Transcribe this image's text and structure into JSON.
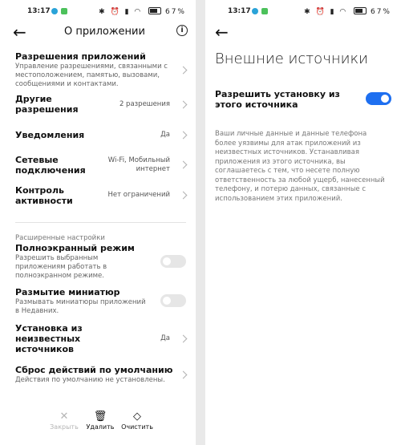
{
  "status_bar": {
    "time": "13:17",
    "battery": "67"
  },
  "left": {
    "title": "О приложении",
    "rows": [
      {
        "label": "Разрешения приложений",
        "desc": "Управление разрешениями, связанными с местоположением, памятью, вызовами, сообщениями и контактами."
      },
      {
        "label": "Другие разрешения",
        "value": "2 разрешения"
      },
      {
        "label": "Уведомления",
        "value": "Да"
      },
      {
        "label": "Сетевые подключения",
        "value": "Wi-Fi, Мобильный интернет"
      },
      {
        "label": "Контроль активности",
        "value": "Нет ограничений"
      }
    ],
    "advanced_title": "Расширенные настройки",
    "fullscreen": {
      "label": "Полноэкранный режим",
      "desc": "Разрешить выбранным приложениям работать в полноэкранном режиме."
    },
    "blur": {
      "label": "Размытие миниатюр",
      "desc": "Размывать миниатюры приложений в Недавних."
    },
    "unknown_sources": {
      "label": "Установка из неизвестных источников",
      "value": "Да"
    },
    "reset": {
      "label": "Сброс действий по умолчанию",
      "desc": "Действия по умолчанию не установлены."
    },
    "bottom": {
      "close": "Закрыть",
      "delete": "Удалить",
      "clear": "Очистить"
    }
  },
  "right": {
    "title": "Внешние источники",
    "allow_label": "Разрешить установку из этого источника",
    "allow_enabled": true,
    "warning": "Ваши личные данные и данные телефона более уязвимы для атак приложений из неизвестных источников. Устанавливая приложения из этого источника, вы соглашаетесь с тем, что несете полную ответственность за любой ущерб, нанесенный телефону, и потерю данных, связанные с использованием этих приложений."
  },
  "colors": {
    "accent": "#1e6ff0"
  }
}
